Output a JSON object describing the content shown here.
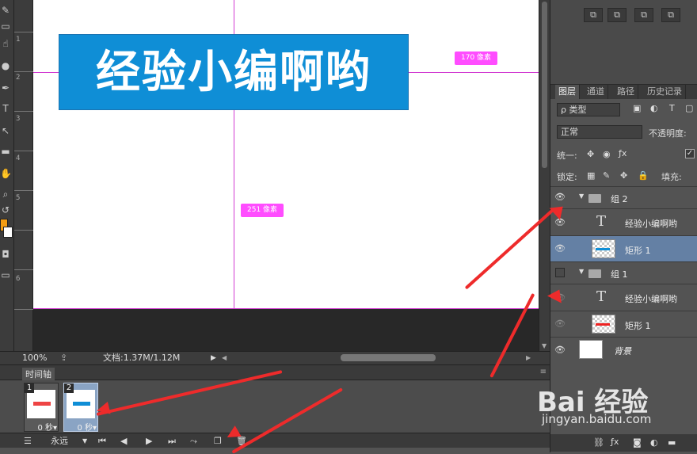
{
  "canvas": {
    "banner_text": "经验小编啊哟",
    "measure_top": "170 像素",
    "measure_bottom": "251 像素",
    "banner_color": "#0f8ed6",
    "guide_color": "#d23bd2"
  },
  "ruler_numbers": [
    "1",
    "2",
    "3",
    "4",
    "5",
    "6"
  ],
  "status": {
    "zoom": "100%",
    "doc_info": "文档:1.37M/1.12M"
  },
  "timeline": {
    "tab_label": "时间轴",
    "frames": [
      {
        "number": "1",
        "delay": "0 秒▾"
      },
      {
        "number": "2",
        "delay": "0 秒▾"
      }
    ],
    "loop_value": "永远"
  },
  "layers_panel": {
    "tabs": [
      "图层",
      "通道",
      "路径",
      "历史记录"
    ],
    "kind_filter": "ρ 类型",
    "blend_mode": "正常",
    "opacity_label": "不透明度:",
    "unify_label": "统一:",
    "lock_label": "锁定:",
    "fill_label": "填充:",
    "layers": [
      {
        "name": "组 2",
        "type": "group"
      },
      {
        "name": "经验小编啊哟",
        "type": "text"
      },
      {
        "name": "矩形 1",
        "type": "shape"
      },
      {
        "name": "组 1",
        "type": "group"
      },
      {
        "name": "经验小编啊哟",
        "type": "text"
      },
      {
        "name": "矩形 1",
        "type": "shape"
      },
      {
        "name": "背景",
        "type": "background"
      }
    ]
  },
  "watermark": {
    "logo": "Bai 经验",
    "url": "jingyan.baidu.com"
  }
}
